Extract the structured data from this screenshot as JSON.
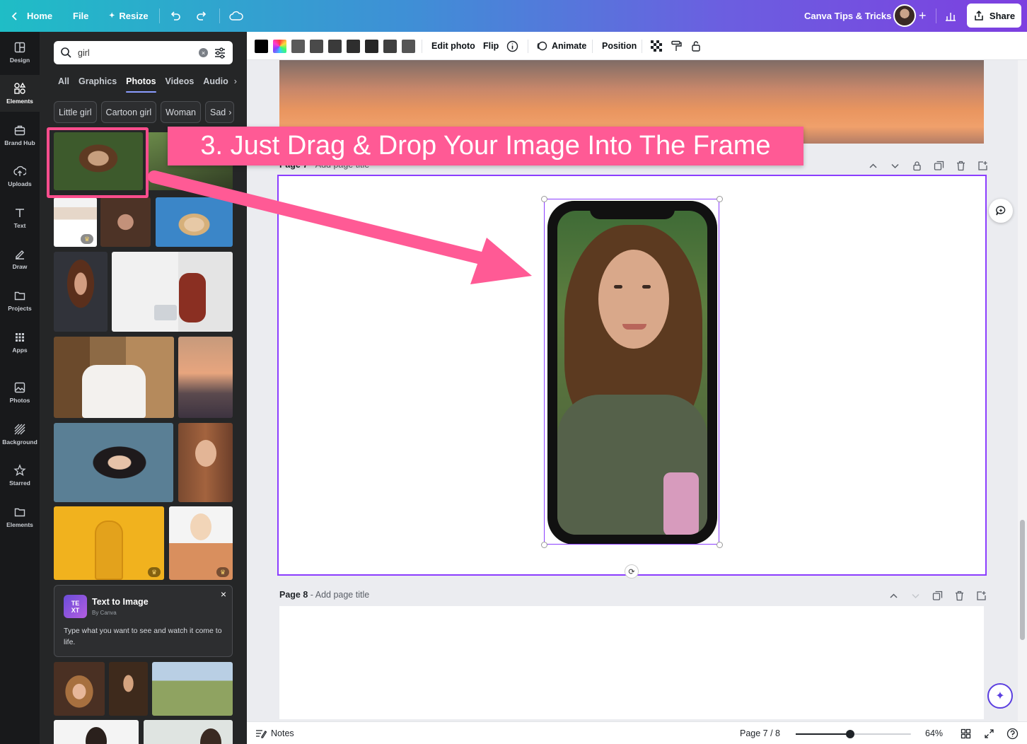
{
  "topbar": {
    "home": "Home",
    "file": "File",
    "resize": "Resize",
    "team": "Canva Tips & Tricks",
    "share": "Share"
  },
  "rail": [
    {
      "label": "Design",
      "icon": "layout-icon"
    },
    {
      "label": "Elements",
      "icon": "shapes-icon",
      "active": true
    },
    {
      "label": "Brand Hub",
      "icon": "briefcase-icon"
    },
    {
      "label": "Uploads",
      "icon": "cloud-upload-icon"
    },
    {
      "label": "Text",
      "icon": "text-icon"
    },
    {
      "label": "Draw",
      "icon": "pen-icon"
    },
    {
      "label": "Projects",
      "icon": "folder-icon"
    },
    {
      "label": "Apps",
      "icon": "grid-icon"
    },
    {
      "label": "Photos",
      "icon": "image-icon"
    },
    {
      "label": "Background",
      "icon": "stripes-icon"
    },
    {
      "label": "Starred",
      "icon": "star-icon"
    },
    {
      "label": "Elements",
      "icon": "folder-icon"
    }
  ],
  "search": {
    "value": "girl"
  },
  "tabs": [
    "All",
    "Graphics",
    "Photos",
    "Videos",
    "Audio"
  ],
  "active_tab": "Photos",
  "chips": [
    "Little girl",
    "Cartoon girl",
    "Woman",
    "Sad"
  ],
  "text_to_image": {
    "title": "Text to Image",
    "subtitle": "By Canva",
    "description": "Type what you want to see and watch it come to life."
  },
  "toolbar": {
    "swatches": [
      "#000000",
      "rainbow",
      "#5a5a5a",
      "#4a4a4a",
      "#3a3a3a",
      "#2e2e2e",
      "#262626",
      "#555555"
    ],
    "edit_photo": "Edit photo",
    "flip": "Flip",
    "animate": "Animate",
    "position": "Position"
  },
  "canvas": {
    "page7_label": "Page 7",
    "page7_title": "Add page title",
    "page8_label": "Page 8",
    "page8_title": "Add page title"
  },
  "bottombar": {
    "notes": "Notes",
    "page_indicator": "Page 7 / 8",
    "zoom": "64%",
    "zoom_fraction": 0.47
  },
  "annotation": {
    "text": "3. Just Drag & Drop Your Image Into The Frame"
  },
  "colors": {
    "accent": "#8b3dff",
    "annotation": "#ff5a95"
  }
}
